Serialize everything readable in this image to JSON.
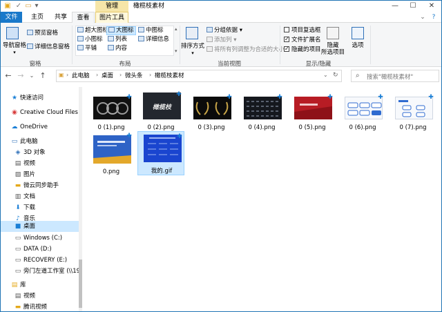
{
  "window": {
    "title": "橄榄枝素材",
    "manage_tab": "管理",
    "controls": {
      "min": "—",
      "max": "☐",
      "close": "✕"
    }
  },
  "tabs": {
    "file": "文件",
    "home": "主页",
    "share": "共享",
    "view": "查看",
    "picture_tools": "图片工具"
  },
  "ribbon": {
    "panes": {
      "nav_pane": "导航窗格",
      "preview_pane": "预览窗格",
      "details_pane": "详细信息窗格",
      "group_label": "窗格"
    },
    "layout": {
      "items": [
        "超大图标",
        "大图标",
        "中图标",
        "小图标",
        "列表",
        "详细信息",
        "平铺",
        "内容"
      ],
      "selected": "大图标",
      "group_label": "布局"
    },
    "current_view": {
      "sort_by": "排序方式",
      "group_by": "分组依据",
      "add_column": "添加列",
      "fit_columns": "将所有列调整为合适的大小",
      "group_label": "当前视图"
    },
    "show_hide": {
      "item_checkboxes": "项目复选框",
      "file_extensions": "文件扩展名",
      "hidden_items": "隐藏的项目",
      "hide_selected": "隐藏",
      "hide_selected_2": "所选项目",
      "options": "选项",
      "group_label": "显示/隐藏",
      "checks": {
        "item_checkboxes": false,
        "file_extensions": true,
        "hidden_items": true
      }
    }
  },
  "address": {
    "crumbs": [
      "此电脑",
      "桌面",
      "微头条",
      "橄榄枝素材"
    ],
    "search_placeholder": "搜索\"橄榄枝素材\""
  },
  "navpane": {
    "items": [
      {
        "label": "快速访问",
        "icon": "star-icon"
      },
      {
        "label": "Creative Cloud Files",
        "icon": "creative-cloud-icon"
      },
      {
        "label": "OneDrive",
        "icon": "cloud-icon"
      },
      {
        "label": "此电脑",
        "icon": "computer-icon"
      },
      {
        "label": "3D 对象",
        "icon": "cube-icon"
      },
      {
        "label": "视频",
        "icon": "video-icon"
      },
      {
        "label": "图片",
        "icon": "picture-icon"
      },
      {
        "label": "微云同步助手",
        "icon": "folder-icon"
      },
      {
        "label": "文档",
        "icon": "document-icon"
      },
      {
        "label": "下载",
        "icon": "download-icon"
      },
      {
        "label": "音乐",
        "icon": "music-icon"
      },
      {
        "label": "桌面",
        "icon": "desktop-icon"
      },
      {
        "label": "Windows (C:)",
        "icon": "drive-icon"
      },
      {
        "label": "DATA (D:)",
        "icon": "drive-icon"
      },
      {
        "label": "RECOVERY (E:)",
        "icon": "drive-icon"
      },
      {
        "label": "旁门左道工作室 (\\\\19",
        "icon": "network-drive-icon"
      },
      {
        "label": "库",
        "icon": "library-icon"
      },
      {
        "label": "视频",
        "icon": "video-icon"
      },
      {
        "label": "腾讯视频",
        "icon": "folder-icon"
      }
    ],
    "selected": "桌面"
  },
  "files": [
    {
      "name": "0 (1).png",
      "thumb": "dark-laurel"
    },
    {
      "name": "0 (2).png",
      "thumb": "dark-text-logo"
    },
    {
      "name": "0 (3).png",
      "thumb": "gold-laurel"
    },
    {
      "name": "0 (4).png",
      "thumb": "dark-grid"
    },
    {
      "name": "0 (5).png",
      "thumb": "red-slide"
    },
    {
      "name": "0 (6).png",
      "thumb": "white-blue-diagram"
    },
    {
      "name": "0 (7).png",
      "thumb": "white-blue-diagram-2"
    },
    {
      "name": "0.png",
      "thumb": "blue-gold-slide"
    },
    {
      "name": "我的.gif",
      "thumb": "blue-slide",
      "selected": true
    }
  ],
  "thumb_text": {
    "dark_logo": "橄榄枝"
  },
  "colors": {
    "accent": "#1979ca",
    "selection": "#cce8ff",
    "manage_tab": "#f6e6a8"
  }
}
